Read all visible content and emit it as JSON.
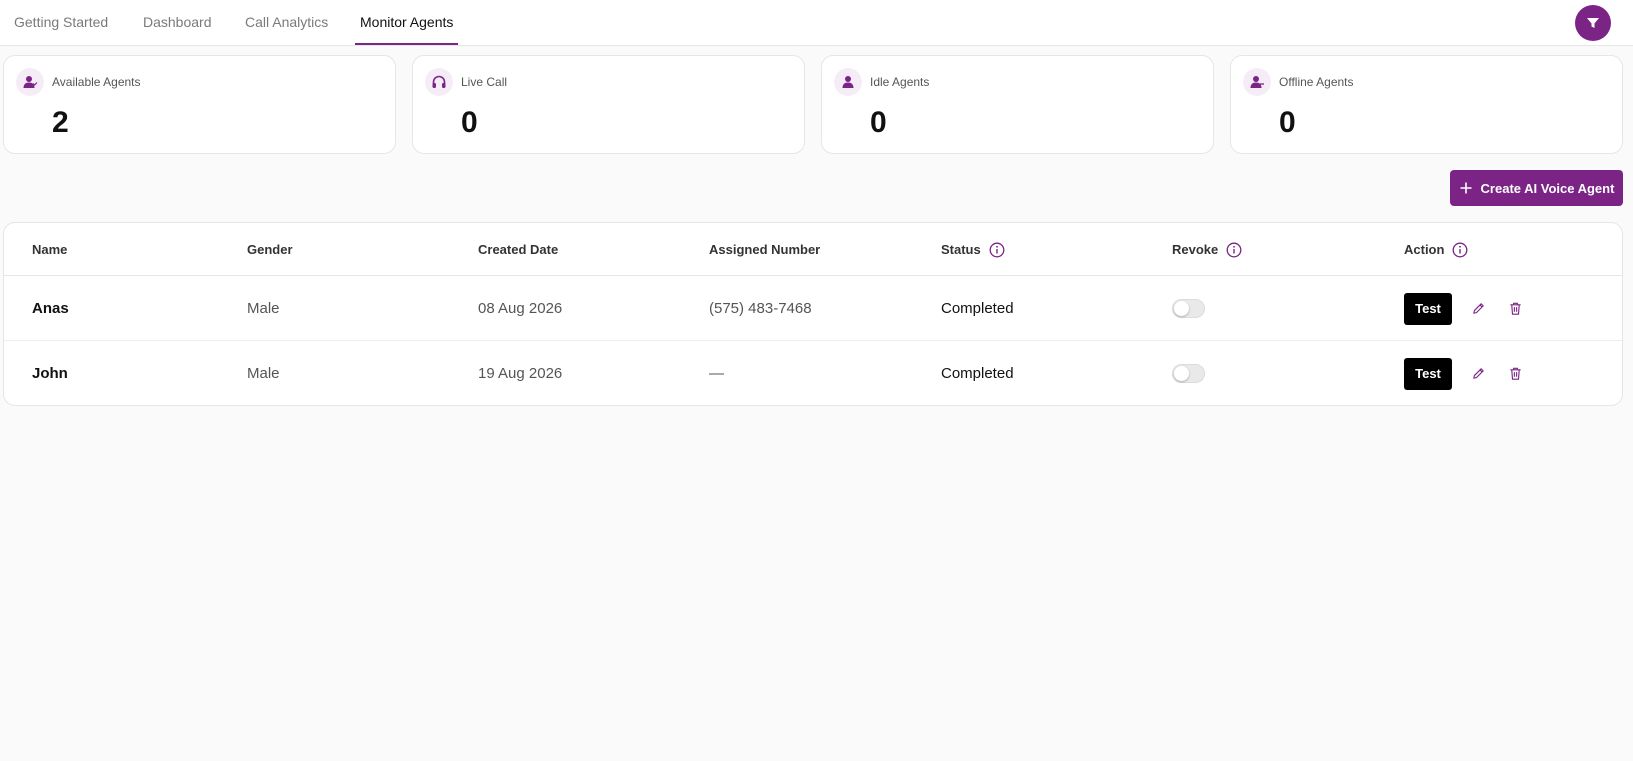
{
  "tabs": [
    {
      "label": "Getting Started",
      "active": false
    },
    {
      "label": "Dashboard",
      "active": false
    },
    {
      "label": "Call Analytics",
      "active": false
    },
    {
      "label": "Monitor Agents",
      "active": true
    }
  ],
  "filter_icon": "filter-icon",
  "stats": [
    {
      "label": "Available Agents",
      "value": "2",
      "icon": "available-agent-icon"
    },
    {
      "label": "Live Call",
      "value": "0",
      "icon": "headphones-icon"
    },
    {
      "label": "Idle Agents",
      "value": "0",
      "icon": "idle-agent-icon"
    },
    {
      "label": "Offline Agents",
      "value": "0",
      "icon": "offline-agent-icon"
    }
  ],
  "create_button": {
    "label": "Create AI Voice Agent",
    "icon": "plus-icon"
  },
  "table": {
    "headers": {
      "name": "Name",
      "gender": "Gender",
      "created_date": "Created Date",
      "assigned_number": "Assigned Number",
      "status": "Status",
      "revoke": "Revoke",
      "action": "Action"
    },
    "rows": [
      {
        "name": "Anas",
        "gender": "Male",
        "created_date": "08 Aug 2026",
        "assigned_number": "(575) 483-7468",
        "status": "Completed",
        "revoke": false,
        "test_label": "Test"
      },
      {
        "name": "John",
        "gender": "Male",
        "created_date": "19 Aug 2026",
        "assigned_number": "—",
        "status": "Completed",
        "revoke": false,
        "test_label": "Test"
      }
    ]
  },
  "colors": {
    "accent": "#7b2486",
    "accent_light": "#f6ecf7"
  }
}
